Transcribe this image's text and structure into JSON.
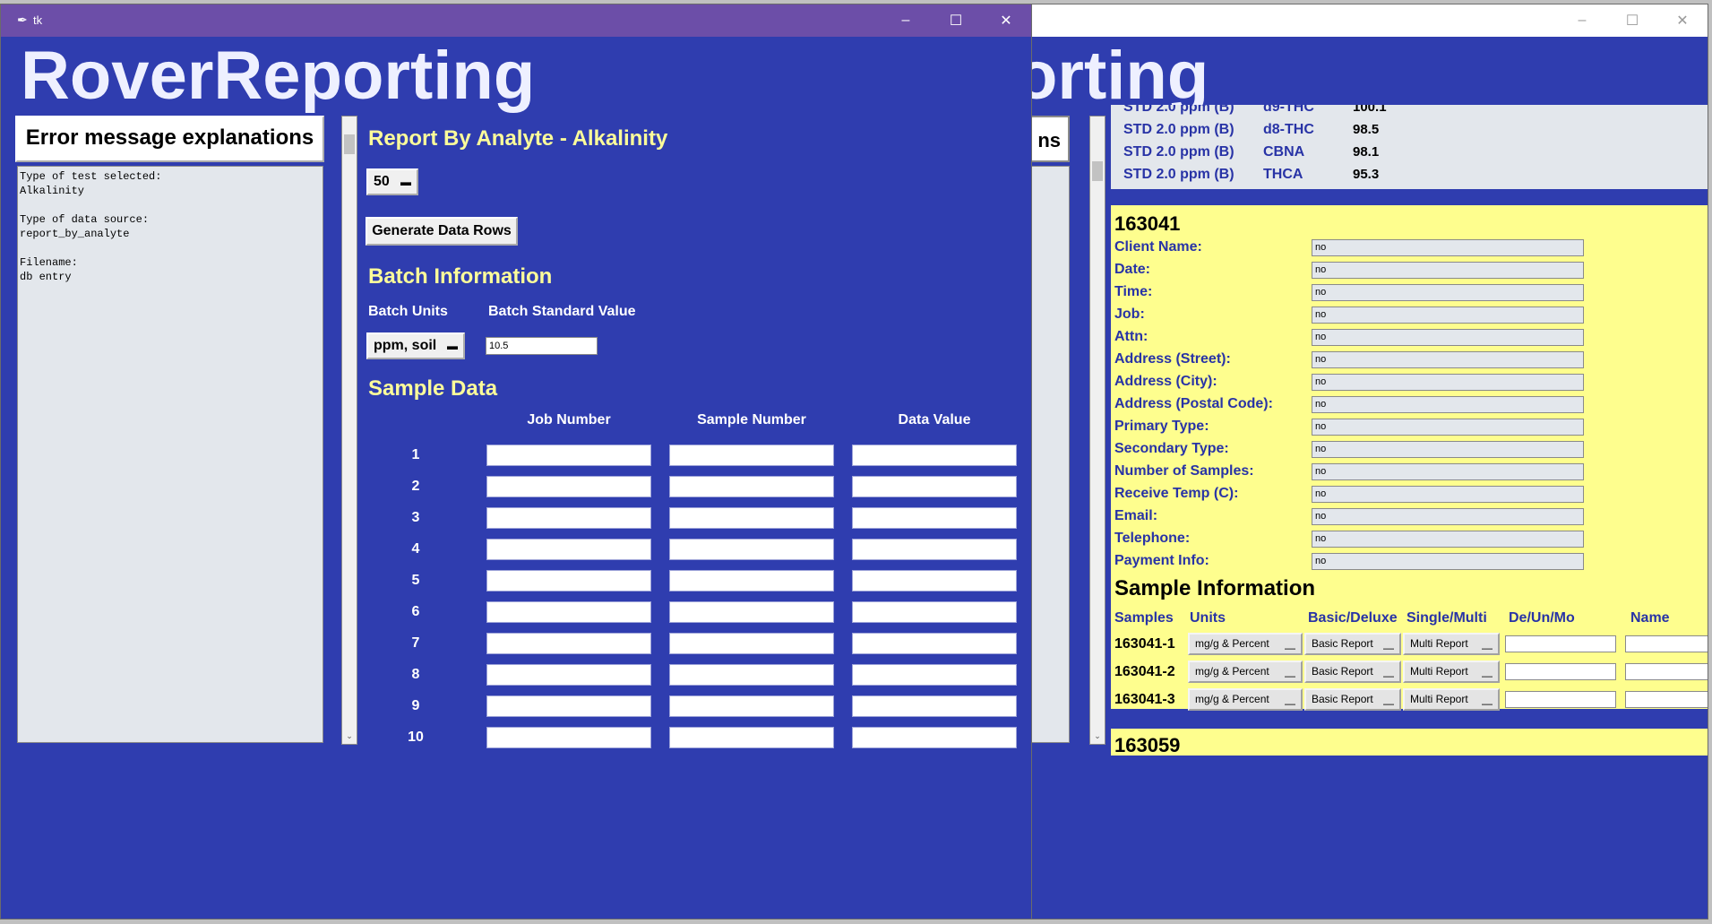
{
  "back_window": {
    "title_fragment": "orting",
    "tab_fragment": "ns",
    "std_rows": [
      {
        "std": "STD 2.0 ppm (B)",
        "analyte": "d9-THC",
        "value": "100.1"
      },
      {
        "std": "STD 2.0 ppm (B)",
        "analyte": "d8-THC",
        "value": "98.5"
      },
      {
        "std": "STD 2.0 ppm (B)",
        "analyte": "CBNA",
        "value": "98.1"
      },
      {
        "std": "STD 2.0 ppm (B)",
        "analyte": "THCA",
        "value": "95.3"
      }
    ],
    "job_id": "163041",
    "client_fields": [
      {
        "label": "Client Name:",
        "value": "no"
      },
      {
        "label": "Date:",
        "value": "no"
      },
      {
        "label": "Time:",
        "value": "no"
      },
      {
        "label": "Job:",
        "value": "no"
      },
      {
        "label": "Attn:",
        "value": "no"
      },
      {
        "label": "Address (Street):",
        "value": "no"
      },
      {
        "label": "Address (City):",
        "value": "no"
      },
      {
        "label": "Address (Postal Code):",
        "value": "no"
      },
      {
        "label": "Primary Type:",
        "value": "no"
      },
      {
        "label": "Secondary Type:",
        "value": "no"
      },
      {
        "label": "Number of Samples:",
        "value": "no"
      },
      {
        "label": "Receive Temp (C):",
        "value": "no"
      },
      {
        "label": "Email:",
        "value": "no"
      },
      {
        "label": "Telephone:",
        "value": "no"
      },
      {
        "label": "Payment Info:",
        "value": "no"
      }
    ],
    "sample_info_heading": "Sample Information",
    "sample_headers": [
      "Samples",
      "Units",
      "Basic/Deluxe",
      "Single/Multi",
      "De/Un/Mo",
      "Name"
    ],
    "samples": [
      {
        "id": "163041-1",
        "units": "mg/g & Percent",
        "report": "Basic Report",
        "multi": "Multi Report"
      },
      {
        "id": "163041-2",
        "units": "mg/g & Percent",
        "report": "Basic Report",
        "multi": "Multi Report"
      },
      {
        "id": "163041-3",
        "units": "mg/g & Percent",
        "report": "Basic Report",
        "multi": "Multi Report"
      }
    ],
    "next_job_id": "163059"
  },
  "front_window": {
    "window_title": "tk",
    "app_title": "RoverReporting",
    "error_button_label": "Error message explanations",
    "info_text": "Type of test selected:\nAlkalinity\n\nType of data source:\nreport_by_analyte\n\nFilename:\ndb entry",
    "report_heading": "Report By Analyte - Alkalinity",
    "row_count_value": "50",
    "generate_button_label": "Generate Data Rows",
    "batch_heading": "Batch Information",
    "batch_units_label": "Batch Units",
    "batch_standard_label": "Batch Standard Value",
    "batch_units_value": "ppm, soil",
    "batch_standard_value": "10.5",
    "sample_heading": "Sample Data",
    "columns": [
      "Job Number",
      "Sample Number",
      "Data Value"
    ],
    "rows": [
      "1",
      "2",
      "3",
      "4",
      "5",
      "6",
      "7",
      "8",
      "9",
      "10"
    ]
  },
  "icons": {
    "minimize": "minimize-icon",
    "maximize": "maximize-icon",
    "close": "close-icon",
    "app": "feather-icon",
    "dropdown": "dropdown-marker-icon"
  },
  "colors": {
    "window_bg": "#2f3daf",
    "title_bar": "#6c4ea8",
    "heading_yellow": "#fcfc9a",
    "panel_yellow": "#fefe8e",
    "label_blue": "#2833a6"
  }
}
